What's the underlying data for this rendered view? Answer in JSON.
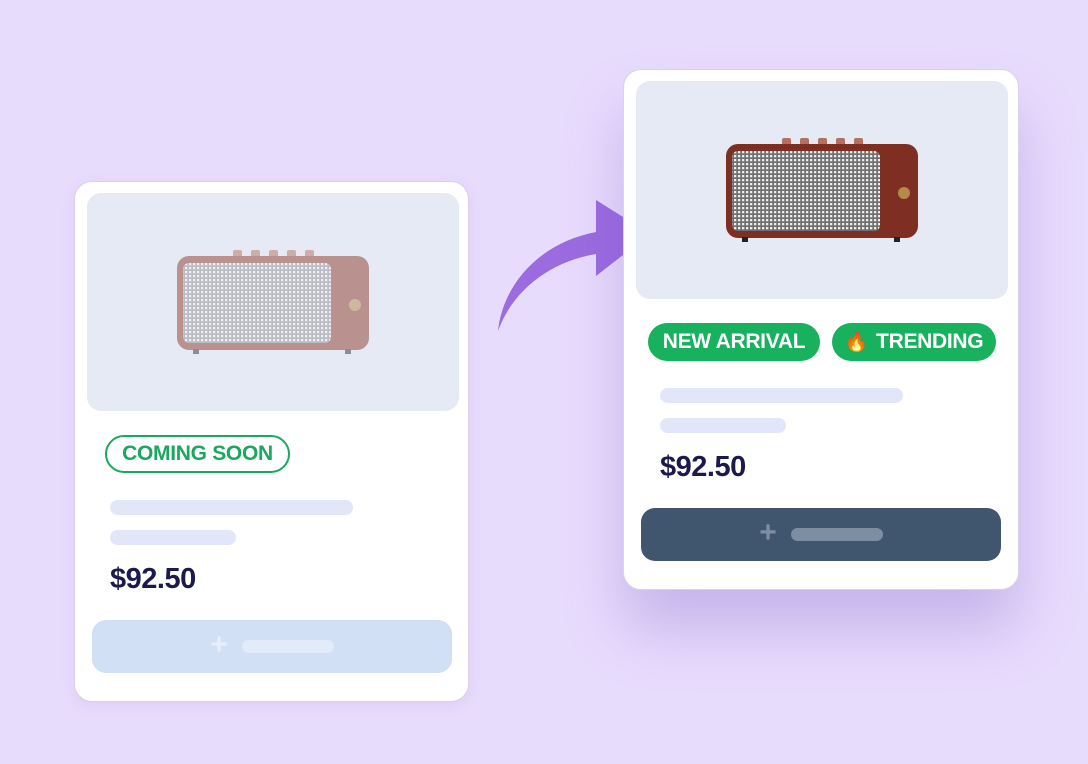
{
  "colors": {
    "background": "#e8dcfd",
    "accent_purple": "#9b6be0",
    "badge_green": "#18b15e",
    "price_navy": "#1c1a4d",
    "button_disabled": "#d2e0f6",
    "button_active": "#40566f"
  },
  "left_card": {
    "badge": "COMING SOON",
    "price": "$92.50",
    "add_icon": "plus-icon",
    "state": "disabled"
  },
  "right_card": {
    "badges": [
      {
        "label": "NEW ARRIVAL",
        "icon": ""
      },
      {
        "label": "TRENDING",
        "icon": "🔥"
      }
    ],
    "price": "$92.50",
    "add_icon": "plus-icon",
    "state": "active"
  },
  "transition_arrow_icon": "curved-arrow-icon"
}
